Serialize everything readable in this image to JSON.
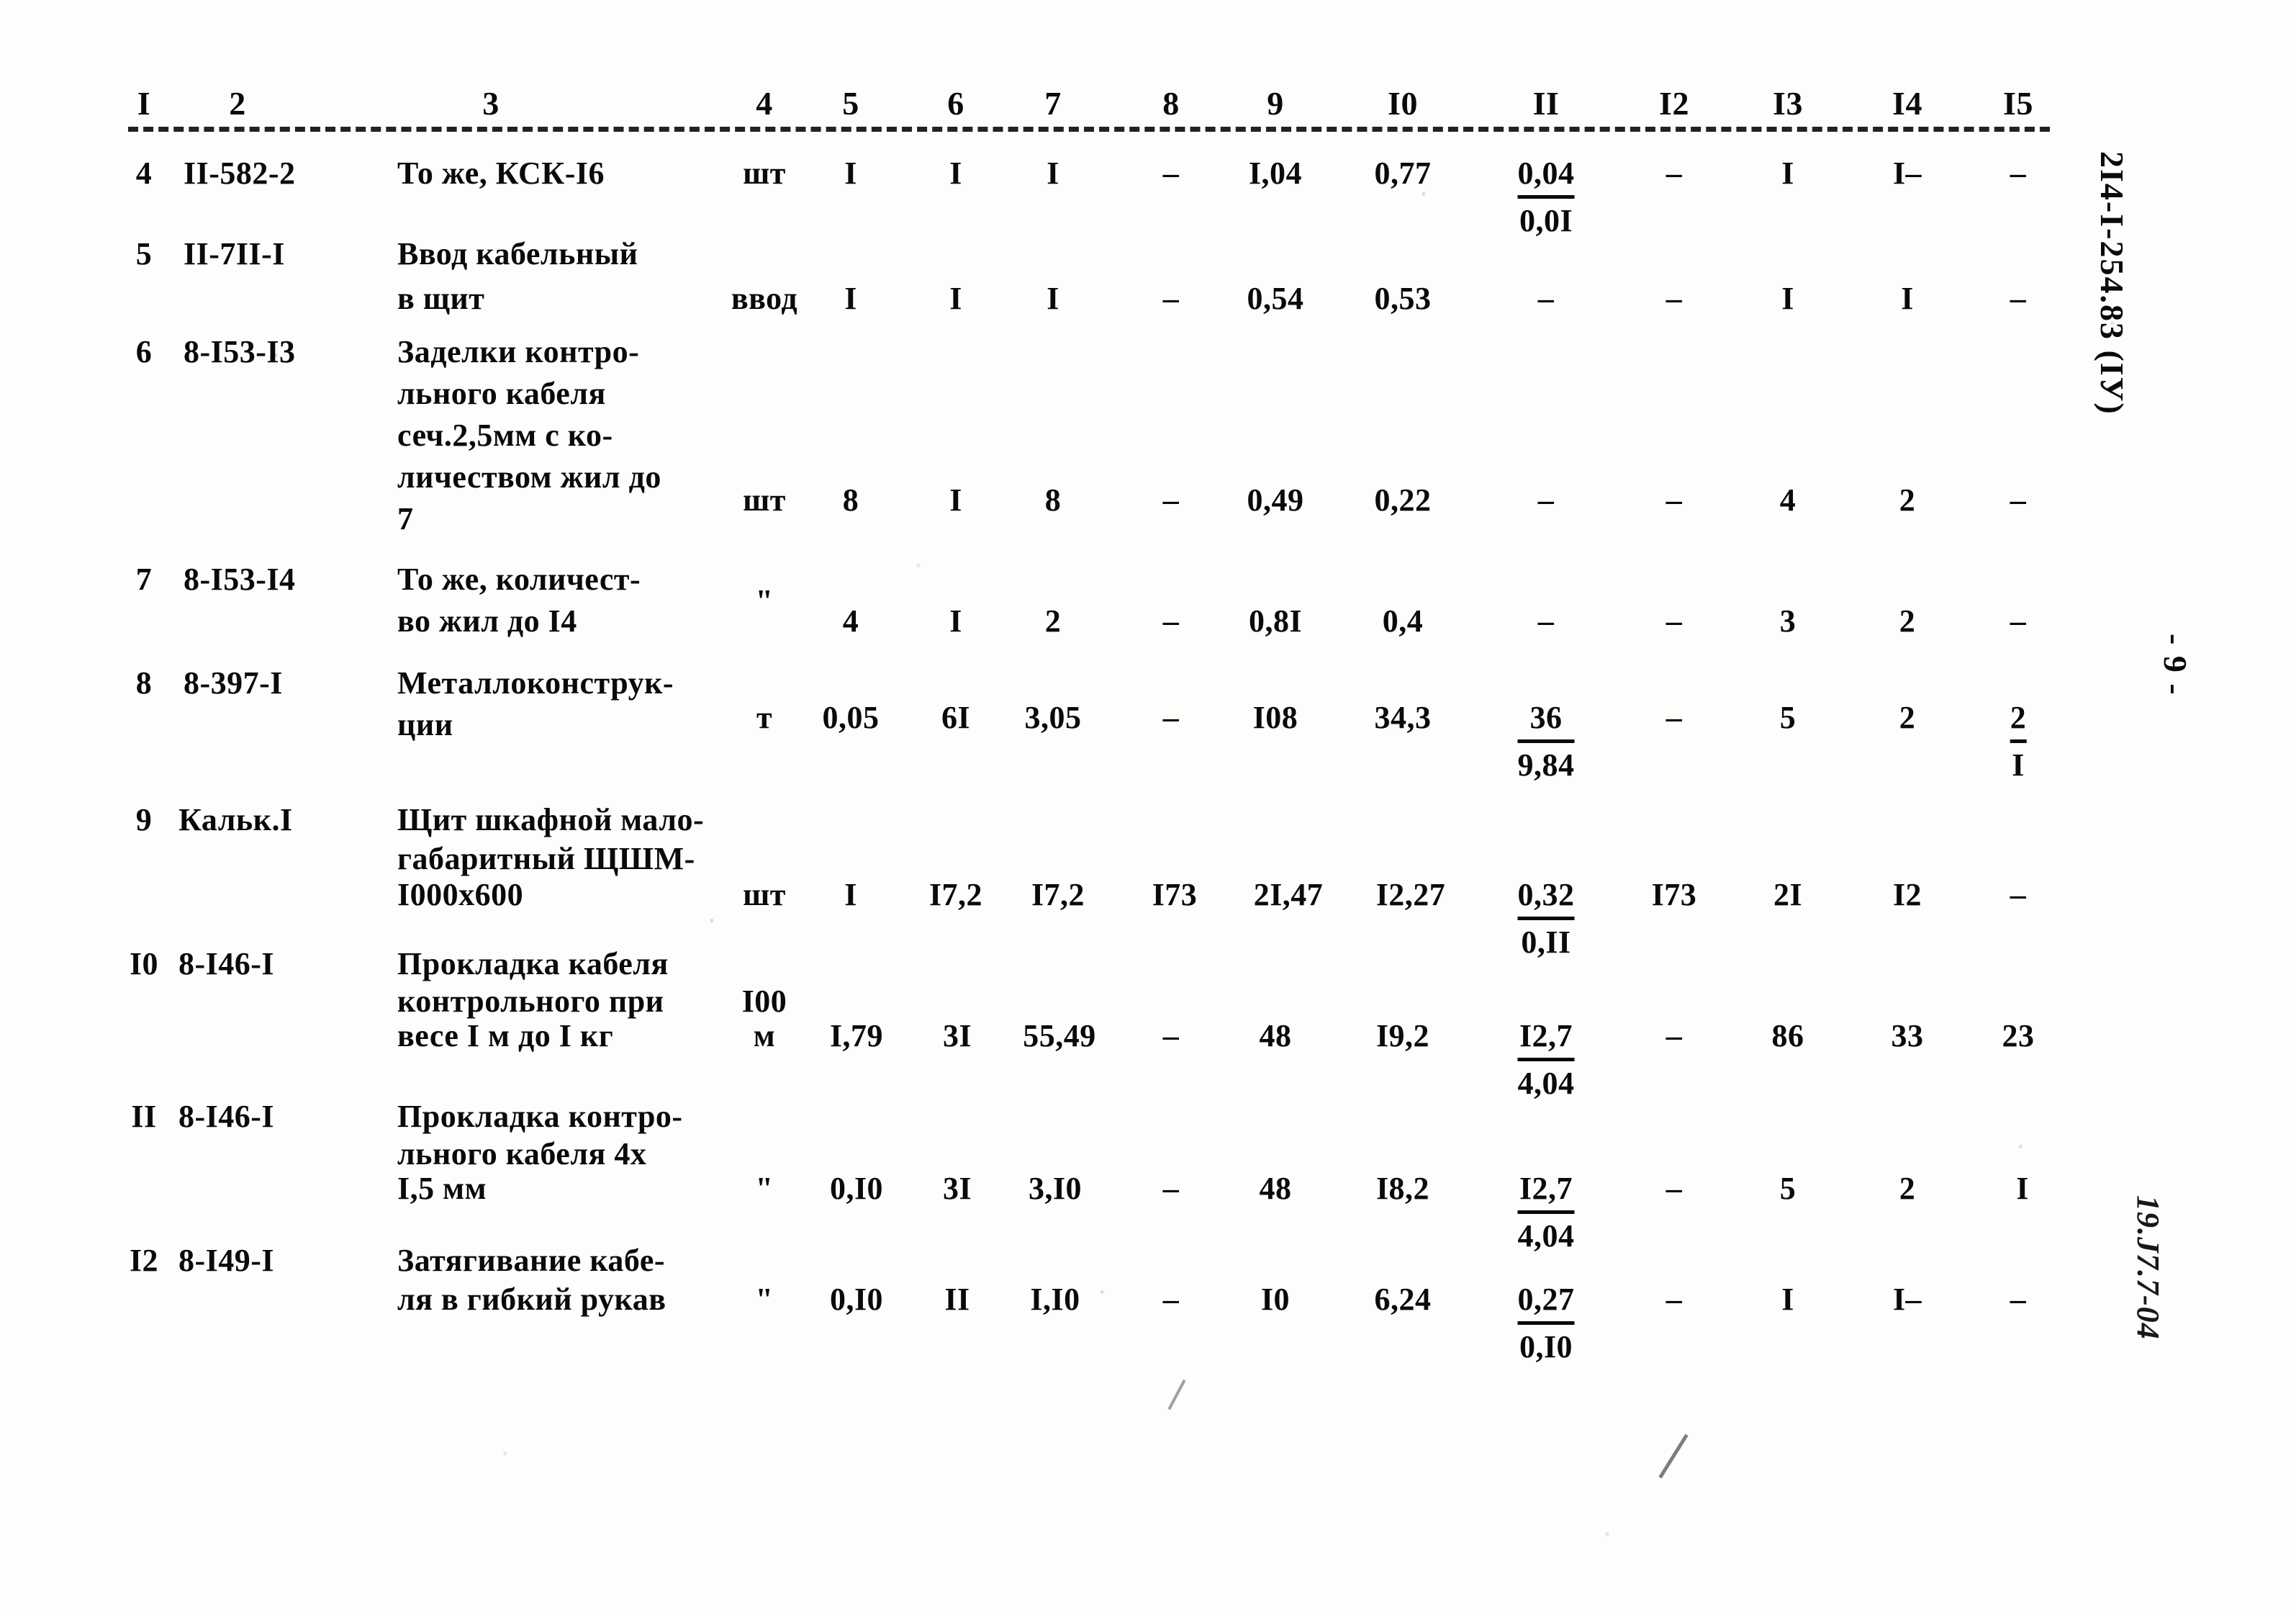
{
  "document": {
    "kind": "scanned-estimate-table",
    "doc_code": "2I4-I-254.83 (IУ)",
    "page_number": "- 9 -",
    "archive_mark": "19.J7.7-04"
  },
  "table": {
    "column_numbers": [
      "I",
      "2",
      "3",
      "4",
      "5",
      "6",
      "7",
      "8",
      "9",
      "I0",
      "II",
      "I2",
      "I3",
      "I4",
      "I5"
    ],
    "rows": [
      {
        "no": "4",
        "code": "II-582-2",
        "name_lines": [
          "То же, КСК-I6"
        ],
        "unit": "шт",
        "c5": "I",
        "c6": "I",
        "c7": "I",
        "c8": "–",
        "c9": "I,04",
        "c10": "0,77",
        "c11_top": "0,04",
        "c11_bot": "0,0I",
        "c12": "–",
        "c13": "I",
        "c14": "I–",
        "c15": "–"
      },
      {
        "no": "5",
        "code": "II-7II-I",
        "name_lines": [
          "Ввод кабельный",
          "в щит"
        ],
        "unit": "ввод",
        "c5": "I",
        "c6": "I",
        "c7": "I",
        "c8": "–",
        "c9": "0,54",
        "c10": "0,53",
        "c11_top": "–",
        "c11_bot": "",
        "c12": "–",
        "c13": "I",
        "c14": "I",
        "c15": "–"
      },
      {
        "no": "6",
        "code": "8-I53-I3",
        "name_lines": [
          "Заделки контро-",
          "льного кабеля",
          "сеч.2,5мм с ко-",
          "личеством жил до",
          "7"
        ],
        "unit": "шт",
        "c5": "8",
        "c6": "I",
        "c7": "8",
        "c8": "–",
        "c9": "0,49",
        "c10": "0,22",
        "c11_top": "–",
        "c11_bot": "",
        "c12": "–",
        "c13": "4",
        "c14": "2",
        "c15": "–"
      },
      {
        "no": "7",
        "code": "8-I53-I4",
        "name_lines": [
          "То же, количест-",
          "во жил до I4"
        ],
        "unit": "\"",
        "c5": "4",
        "c6": "I",
        "c7": "2",
        "c8": "–",
        "c9": "0,8I",
        "c10": "0,4",
        "c11_top": "–",
        "c11_bot": "",
        "c12": "–",
        "c13": "3",
        "c14": "2",
        "c15": "–"
      },
      {
        "no": "8",
        "code": "8-397-I",
        "name_lines": [
          "Металлоконструк-",
          "ции"
        ],
        "unit": "т",
        "c5": "0,05",
        "c6": "6I",
        "c7": "3,05",
        "c8": "–",
        "c9": "I08",
        "c10": "34,3",
        "c11_top": "36",
        "c11_bot": "9,84",
        "c12": "–",
        "c13": "5",
        "c14": "2",
        "c15_top": "2",
        "c15_bot": "I"
      },
      {
        "no": "9",
        "code": "Кальк.I",
        "name_lines": [
          "Щит шкафной мало-",
          "габаритный ЩШМ-",
          "I000х600"
        ],
        "unit": "шт",
        "c5": "I",
        "c6": "I7,2",
        "c7": "I7,2",
        "c8": "I73",
        "c9": "2I,47",
        "c10": "I2,27",
        "c11_top": "0,32",
        "c11_bot": "0,II",
        "c12": "I73",
        "c13": "2I",
        "c14": "I2",
        "c15": "–"
      },
      {
        "no": "I0",
        "code": "8-I46-I",
        "name_lines": [
          "Прокладка кабеля",
          "контрольного при",
          "весе I м до I кг"
        ],
        "unit_lines": [
          "I00",
          "м"
        ],
        "c5": "I,79",
        "c6": "3I",
        "c7": "55,49",
        "c8": "–",
        "c9": "48",
        "c10": "I9,2",
        "c11_top": "I2,7",
        "c11_bot": "4,04",
        "c12": "–",
        "c13": "86",
        "c14": "33",
        "c15": "23"
      },
      {
        "no": "II",
        "code": "8-I46-I",
        "name_lines": [
          "Прокладка контро-",
          "льного кабеля 4х",
          "I,5 мм"
        ],
        "unit": "\"",
        "c5": "0,I0",
        "c6": "3I",
        "c7": "3,I0",
        "c8": "–",
        "c9": "48",
        "c10": "I8,2",
        "c11_top": "I2,7",
        "c11_bot": "4,04",
        "c12": "–",
        "c13": "5",
        "c14": "2",
        "c15": "I"
      },
      {
        "no": "I2",
        "code": "8-I49-I",
        "name_lines": [
          "Затягивание кабе-",
          "ля в гибкий рукав"
        ],
        "unit": "\"",
        "c5": "0,I0",
        "c6": "II",
        "c7": "I,I0",
        "c8": "–",
        "c9": "I0",
        "c10": "6,24",
        "c11_top": "0,27",
        "c11_bot": "0,I0",
        "c12": "–",
        "c13": "I",
        "c14": "I–",
        "c15": "–"
      }
    ]
  }
}
